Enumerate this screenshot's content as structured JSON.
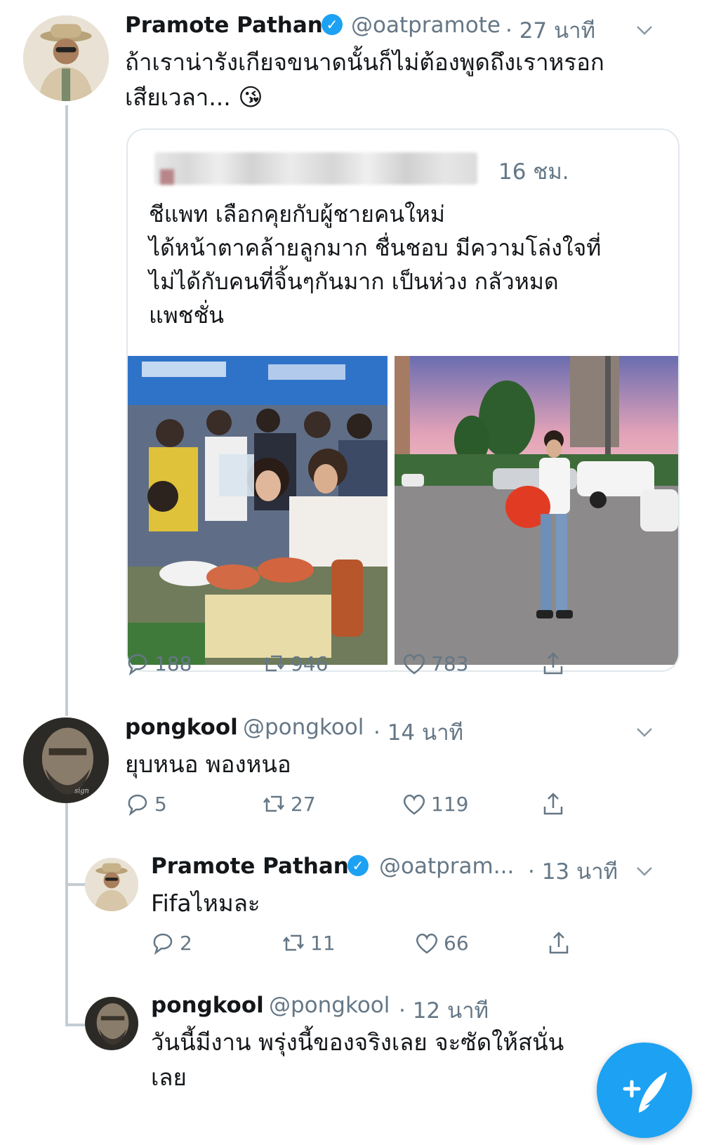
{
  "colors": {
    "accent": "#1da1f2",
    "muted": "#657786",
    "line": "#c4ccd3"
  },
  "tweet1": {
    "name": "Pramote Pathan",
    "handle": "@oatpramote",
    "time": "· 27 นาที",
    "text_line1": "ถ้าเราน่ารังเกียจขนาดนั้นก็ไม่ต้องพูดถึงเราหรอก",
    "text_line2": "เสียเวลา...",
    "emoji": "😘",
    "quote": {
      "time": "16 ชม.",
      "line1": "ชีแพท เลือกคุยกับผู้ชายคนใหม่",
      "line2": "ได้หน้าตาคล้ายลูกมาก ชื่นชอบ มีความโล่งใจที่",
      "line3": "ไม่ได้กับคนที่จิ้นๆกันมาก เป็นห่วง กลัวหมด",
      "line4": "แพชชั่น"
    },
    "replies": "188",
    "retweets": "946",
    "likes": "783"
  },
  "tweet2": {
    "name": "pongkool",
    "handle": "@pongkool",
    "time": "· 14 นาที",
    "text": "ยุบหนอ พองหนอ",
    "replies": "5",
    "retweets": "27",
    "likes": "119"
  },
  "tweet3": {
    "name": "Pramote Pathan",
    "handle": "@oatpram...",
    "time": "· 13 นาที",
    "text": "Fifaไหมละ",
    "replies": "2",
    "retweets": "11",
    "likes": "66"
  },
  "tweet4": {
    "name": "pongkool",
    "handle": "@pongkool",
    "time": "· 12 นาที",
    "text_line1": "วันนี้มีงาน พรุ่งนี้ของจริงเลย จะซัดให้สนั่น",
    "text_line2": "เลย"
  },
  "icons": {
    "reply": "reply-icon",
    "retweet": "retweet-icon",
    "like": "heart-icon",
    "share": "share-icon",
    "compose": "compose-tweet-icon",
    "verified": "verified-badge-icon",
    "caret": "chevron-down-icon"
  }
}
